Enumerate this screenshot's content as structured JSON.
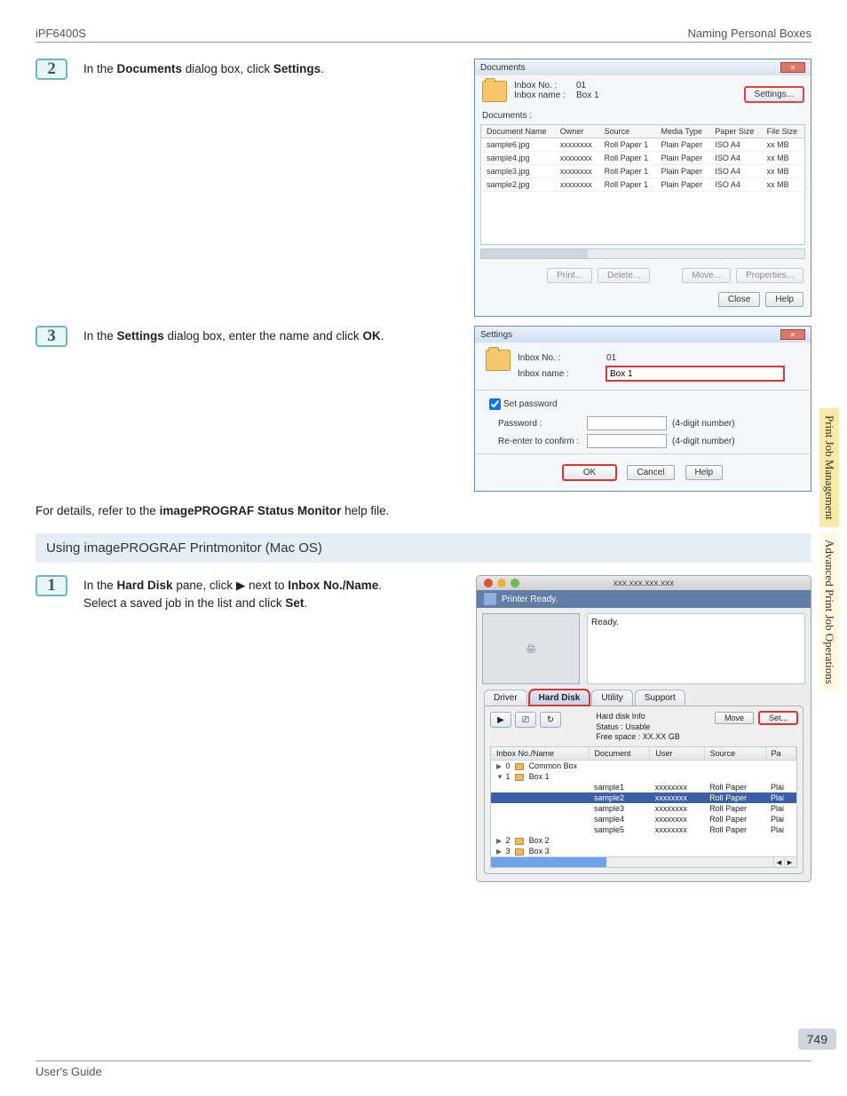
{
  "header": {
    "left": "iPF6400S",
    "right": "Naming Personal Boxes"
  },
  "sidetabs": {
    "tab1": "Print Job Management",
    "tab2": "Advanced Print Job Operations"
  },
  "step2": {
    "num": "2",
    "text_a": "In the ",
    "text_b": "Documents",
    "text_c": " dialog box, click ",
    "text_d": "Settings",
    "text_e": "."
  },
  "doc_dlg": {
    "title": "Documents",
    "inbox_no_label": "Inbox No. :",
    "inbox_no_value": "01",
    "inbox_name_label": "Inbox name :",
    "inbox_name_value": "Box 1",
    "btn_settings": "Settings...",
    "section_label": "Documents :",
    "cols": {
      "c1": "Document Name",
      "c2": "Owner",
      "c3": "Source",
      "c4": "Media Type",
      "c5": "Paper Size",
      "c6": "File Size"
    },
    "rows": [
      {
        "name": "sample6.jpg",
        "owner": "xxxxxxxx",
        "source": "Roll Paper 1",
        "media": "Plain Paper",
        "paper": "ISO A4",
        "size": "xx MB"
      },
      {
        "name": "sample4.jpg",
        "owner": "xxxxxxxx",
        "source": "Roll Paper 1",
        "media": "Plain Paper",
        "paper": "ISO A4",
        "size": "xx MB"
      },
      {
        "name": "sample3.jpg",
        "owner": "xxxxxxxx",
        "source": "Roll Paper 1",
        "media": "Plain Paper",
        "paper": "ISO A4",
        "size": "xx MB"
      },
      {
        "name": "sample2.jpg",
        "owner": "xxxxxxxx",
        "source": "Roll Paper 1",
        "media": "Plain Paper",
        "paper": "ISO A4",
        "size": "xx MB"
      }
    ],
    "btn_print": "Print...",
    "btn_delete": "Delete...",
    "btn_move": "Move...",
    "btn_properties": "Properties...",
    "btn_close": "Close",
    "btn_help": "Help"
  },
  "step3": {
    "num": "3",
    "text_a": "In the ",
    "text_b": "Settings",
    "text_c": " dialog box, enter the name and click ",
    "text_d": "OK",
    "text_e": "."
  },
  "set_dlg": {
    "title": "Settings",
    "inbox_no_label": "Inbox No. :",
    "inbox_no_value": "01",
    "inbox_name_label": "Inbox name :",
    "inbox_name_value": "Box 1",
    "chk_label": "Set password",
    "pass_label": "Password :",
    "pass_hint": "(4-digit number)",
    "confirm_label": "Re-enter to confirm :",
    "confirm_hint": "(4-digit number)",
    "btn_ok": "OK",
    "btn_cancel": "Cancel",
    "btn_help": "Help"
  },
  "note": {
    "a": "For details, refer to the ",
    "b": "imagePROGRAF Status Monitor",
    "c": " help file."
  },
  "section_mac": "Using imagePROGRAF Printmonitor (Mac OS)",
  "step1": {
    "num": "1",
    "text_a": "In the ",
    "text_b": "Hard Disk",
    "text_c": " pane, click ",
    "text_d": "▶",
    "text_e": " next to ",
    "text_f": "Inbox No./Name",
    "text_g": ". Select a saved job in the list and click ",
    "text_h": "Set",
    "text_i": "."
  },
  "mac": {
    "title": "xxx.xxx.xxx.xxx",
    "status": "Printer Ready.",
    "ready": "Ready.",
    "tabs": {
      "driver": "Driver",
      "hd": "Hard Disk",
      "util": "Utility",
      "support": "Support"
    },
    "info": {
      "l1": "Hard disk Info",
      "l2": "Status : Usable",
      "l3": "Free space : XX.XX GB"
    },
    "btn_move": "Move",
    "btn_set": "Set...",
    "cols": {
      "c1": "Inbox No./Name",
      "c2": "Document",
      "c3": "User",
      "c4": "Source",
      "c5": "Pa"
    },
    "tree": {
      "common": "0",
      "common_name": "Common Box",
      "box1": "1",
      "box1_name": "Box 1",
      "box2": "2",
      "box2_name": "Box 2",
      "box3": "3",
      "box3_name": "Box 3"
    },
    "rows": [
      {
        "doc": "sample1",
        "user": "xxxxxxxx",
        "source": "Roll Paper",
        "pa": "Plai"
      },
      {
        "doc": "sample2",
        "user": "xxxxxxxx",
        "source": "Roll Paper",
        "pa": "Plai",
        "sel": true
      },
      {
        "doc": "sample3",
        "user": "xxxxxxxx",
        "source": "Roll Paper",
        "pa": "Plai"
      },
      {
        "doc": "sample4",
        "user": "xxxxxxxx",
        "source": "Roll Paper",
        "pa": "Plai"
      },
      {
        "doc": "sample5",
        "user": "xxxxxxxx",
        "source": "Roll Paper",
        "pa": "Plai"
      }
    ]
  },
  "page_number": "749",
  "footer": "User's Guide"
}
